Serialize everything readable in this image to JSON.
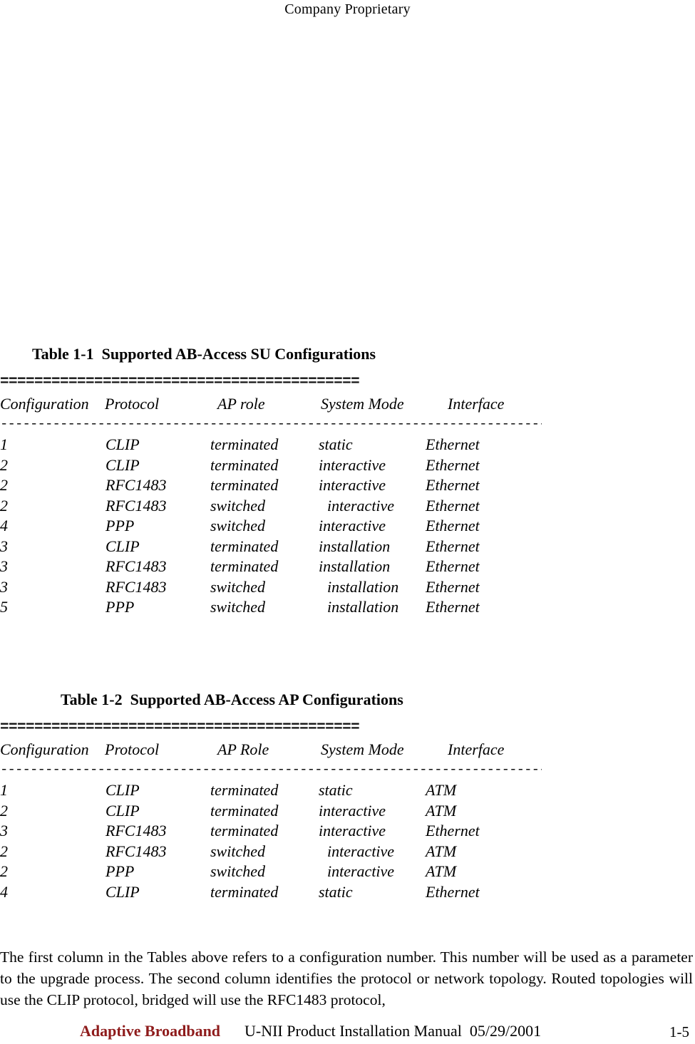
{
  "header": {
    "text": "Company Proprietary"
  },
  "rules": {
    "equals_line": "==========================================",
    "dashes_line": "-----------------------------------------------------------------------------------------"
  },
  "tables": [
    {
      "caption": "Table 1-1  Supported AB-Access SU Configurations",
      "columns": [
        "Configuration",
        "Protocol",
        "AP role",
        "System Mode",
        "Interface"
      ],
      "rows": [
        {
          "configuration": "1",
          "protocol": "CLIP",
          "ap_role": "terminated",
          "system_mode": "static",
          "interface": "Ethernet"
        },
        {
          "configuration": "2",
          "protocol": "CLIP",
          "ap_role": "terminated",
          "system_mode": "interactive",
          "interface": "Ethernet"
        },
        {
          "configuration": "2",
          "protocol": "RFC1483",
          "ap_role": "terminated",
          "system_mode": "interactive",
          "interface": "Ethernet"
        },
        {
          "configuration": "2",
          "protocol": "RFC1483",
          "ap_role": "switched",
          "system_mode": "interactive",
          "interface": "Ethernet"
        },
        {
          "configuration": "4",
          "protocol": "PPP",
          "ap_role": "switched",
          "system_mode": "interactive",
          "interface": "Ethernet"
        },
        {
          "configuration": "3",
          "protocol": "CLIP",
          "ap_role": "terminated",
          "system_mode": "installation",
          "interface": "Ethernet"
        },
        {
          "configuration": "3",
          "protocol": "RFC1483",
          "ap_role": "terminated",
          "system_mode": "installation",
          "interface": "Ethernet"
        },
        {
          "configuration": "3",
          "protocol": "RFC1483",
          "ap_role": "switched",
          "system_mode": "installation",
          "interface": "Ethernet"
        },
        {
          "configuration": "5",
          "protocol": "PPP",
          "ap_role": "switched",
          "system_mode": "installation",
          "interface": "Ethernet"
        }
      ]
    },
    {
      "caption": "Table 1-2  Supported AB-Access AP Configurations",
      "columns": [
        "Configuration",
        "Protocol",
        "AP Role",
        "System Mode",
        "Interface"
      ],
      "rows": [
        {
          "configuration": "1",
          "protocol": "CLIP",
          "ap_role": "terminated",
          "system_mode": "static",
          "interface": "ATM"
        },
        {
          "configuration": "2",
          "protocol": "CLIP",
          "ap_role": "terminated",
          "system_mode": "interactive",
          "interface": "ATM"
        },
        {
          "configuration": "3",
          "protocol": "RFC1483",
          "ap_role": "terminated",
          "system_mode": "interactive",
          "interface": "Ethernet"
        },
        {
          "configuration": "2",
          "protocol": "RFC1483",
          "ap_role": "switched",
          "system_mode": "interactive",
          "interface": "ATM"
        },
        {
          "configuration": "2",
          "protocol": "PPP",
          "ap_role": "switched",
          "system_mode": "interactive",
          "interface": "ATM"
        },
        {
          "configuration": "4",
          "protocol": "CLIP",
          "ap_role": "terminated",
          "system_mode": "static",
          "interface": "Ethernet"
        }
      ]
    }
  ],
  "body": {
    "paragraph": "The first column in the Tables above refers to a configuration number.  This number will be used as a parameter to the upgrade process.  The second column identifies the protocol or network topology.  Routed topologies will use the CLIP protocol, bridged will use the RFC1483 protocol,"
  },
  "footer": {
    "brand": "Adaptive Broadband",
    "brand_color": "#8E1B1B",
    "title": "U-NII Product Installation Manual  05/29/2001",
    "page_number": "1-5"
  }
}
